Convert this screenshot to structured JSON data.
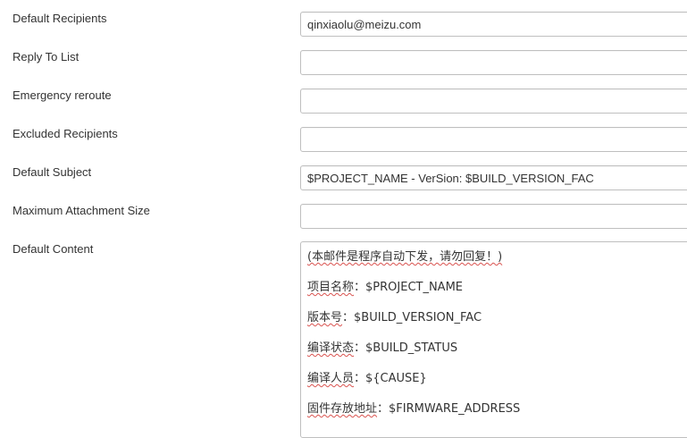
{
  "form": {
    "default_recipients": {
      "label": "Default Recipients",
      "value": "qinxiaolu@meizu.com"
    },
    "reply_to_list": {
      "label": "Reply To List",
      "value": ""
    },
    "emergency_reroute": {
      "label": "Emergency reroute",
      "value": ""
    },
    "excluded_recipients": {
      "label": "Excluded Recipients",
      "value": ""
    },
    "default_subject": {
      "label": "Default Subject",
      "value": "$PROJECT_NAME - VerSion: $BUILD_VERSION_FAC"
    },
    "max_attachment_size": {
      "label": "Maximum Attachment Size",
      "value": ""
    },
    "default_content": {
      "label": "Default Content",
      "lines": [
        {
          "marked": "(本邮件是程序自动下发，请勿回复！)",
          "rest": ""
        },
        {
          "marked": "项目名称",
          "rest": "：$PROJECT_NAME"
        },
        {
          "marked": "版本号",
          "rest": "：$BUILD_VERSION_FAC"
        },
        {
          "marked": "编译状态",
          "rest": "：$BUILD_STATUS"
        },
        {
          "marked": "编译人员",
          "rest": "：${CAUSE}"
        },
        {
          "marked": "固件存放地址",
          "rest": "：$FIRMWARE_ADDRESS"
        }
      ]
    }
  }
}
